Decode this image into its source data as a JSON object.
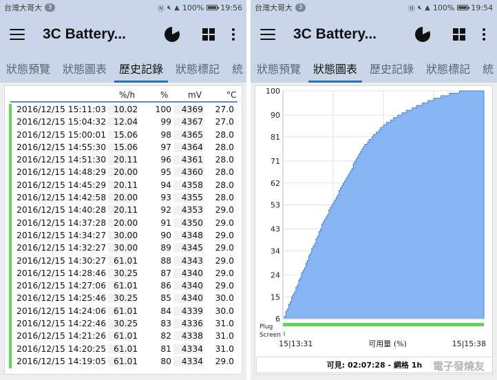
{
  "left": {
    "status": {
      "carrier": "台灣大哥大",
      "carrier_badge": "3",
      "battery": "100%",
      "time": "19:56"
    },
    "app_title": "3C Battery...",
    "tabs": [
      {
        "label": "狀態預覽"
      },
      {
        "label": "狀態圖表"
      },
      {
        "label": "歷史記錄",
        "active": true
      },
      {
        "label": "狀態標記"
      },
      {
        "label": "統"
      }
    ],
    "history": {
      "columns": {
        "rate": "%/h",
        "pct": "%",
        "mv": "mV",
        "temp": "°C"
      },
      "rows": [
        {
          "time": "2016/12/15 15:11:03",
          "rate": "10.02",
          "pct": "100",
          "mv": "4369",
          "temp": "27.0"
        },
        {
          "time": "2016/12/15 15:04:32",
          "rate": "12.04",
          "pct": "99",
          "mv": "4367",
          "temp": "27.0"
        },
        {
          "time": "2016/12/15 15:00:01",
          "rate": "15.06",
          "pct": "98",
          "mv": "4365",
          "temp": "28.0"
        },
        {
          "time": "2016/12/15 14:55:30",
          "rate": "15.06",
          "pct": "97",
          "mv": "4364",
          "temp": "28.0"
        },
        {
          "time": "2016/12/15 14:51:30",
          "rate": "20.11",
          "pct": "96",
          "mv": "4361",
          "temp": "28.0"
        },
        {
          "time": "2016/12/15 14:48:29",
          "rate": "20.00",
          "pct": "95",
          "mv": "4360",
          "temp": "28.0"
        },
        {
          "time": "2016/12/15 14:45:29",
          "rate": "20.11",
          "pct": "94",
          "mv": "4358",
          "temp": "28.0"
        },
        {
          "time": "2016/12/15 14:42:58",
          "rate": "20.00",
          "pct": "93",
          "mv": "4355",
          "temp": "28.0"
        },
        {
          "time": "2016/12/15 14:40:28",
          "rate": "20.11",
          "pct": "92",
          "mv": "4353",
          "temp": "29.0"
        },
        {
          "time": "2016/12/15 14:37:28",
          "rate": "20.00",
          "pct": "91",
          "mv": "4350",
          "temp": "29.0"
        },
        {
          "time": "2016/12/15 14:34:27",
          "rate": "30.00",
          "pct": "90",
          "mv": "4348",
          "temp": "29.0"
        },
        {
          "time": "2016/12/15 14:32:27",
          "rate": "30.00",
          "pct": "89",
          "mv": "4345",
          "temp": "29.0"
        },
        {
          "time": "2016/12/15 14:30:27",
          "rate": "61.01",
          "pct": "88",
          "mv": "4343",
          "temp": "29.0"
        },
        {
          "time": "2016/12/15 14:28:46",
          "rate": "30.25",
          "pct": "87",
          "mv": "4340",
          "temp": "29.0"
        },
        {
          "time": "2016/12/15 14:27:06",
          "rate": "61.01",
          "pct": "86",
          "mv": "4340",
          "temp": "29.0"
        },
        {
          "time": "2016/12/15 14:25:46",
          "rate": "30.25",
          "pct": "85",
          "mv": "4340",
          "temp": "30.0"
        },
        {
          "time": "2016/12/15 14:24:06",
          "rate": "61.01",
          "pct": "84",
          "mv": "4339",
          "temp": "30.0"
        },
        {
          "time": "2016/12/15 14:22:46",
          "rate": "30.25",
          "pct": "83",
          "mv": "4336",
          "temp": "31.0"
        },
        {
          "time": "2016/12/15 14:21:26",
          "rate": "61.01",
          "pct": "82",
          "mv": "4338",
          "temp": "31.0"
        },
        {
          "time": "2016/12/15 14:20:25",
          "rate": "61.01",
          "pct": "81",
          "mv": "4334",
          "temp": "31.0"
        },
        {
          "time": "2016/12/15 14:19:05",
          "rate": "61.01",
          "pct": "80",
          "mv": "4334",
          "temp": "29.0"
        }
      ]
    }
  },
  "right": {
    "status": {
      "carrier": "台灣大哥大",
      "carrier_badge": "3",
      "battery": "100%",
      "time": "19:54"
    },
    "app_title": "3C Battery...",
    "tabs": [
      {
        "label": "狀態預覽"
      },
      {
        "label": "狀態圖表",
        "active": true
      },
      {
        "label": "歷史記錄"
      },
      {
        "label": "狀態標記"
      },
      {
        "label": "統"
      }
    ],
    "plug_label": "Plug",
    "screen_label": "Screen",
    "x_left_label": "15|13:31",
    "x_center_label": "可用量 (%)",
    "x_right_label": "15|15:38",
    "bottom_text": "可見: 02:07:28 - 網格 1h",
    "watermark": "電子發燒友"
  },
  "colors": {
    "fill": "#87b4f2",
    "line": "#4a86d8",
    "plug": "#63d457",
    "accent": "#2c6fb0",
    "toolbar": "#c9d6ea"
  },
  "chart_data": {
    "type": "area",
    "xlabel": "可用量 (%)",
    "x_range": [
      "15|13:31",
      "15|15:38"
    ],
    "y_ticks": [
      6,
      15,
      24,
      34,
      43,
      53,
      62,
      71,
      81,
      90,
      100
    ],
    "ylim": [
      6,
      100
    ],
    "grid": true,
    "x_fraction": [
      0,
      0.1,
      0.2,
      0.3,
      0.4,
      0.5,
      0.6,
      0.7,
      0.8,
      0.9,
      1.0
    ],
    "y": [
      6,
      26,
      46,
      62,
      77,
      86,
      91,
      95,
      98,
      100,
      100
    ]
  }
}
